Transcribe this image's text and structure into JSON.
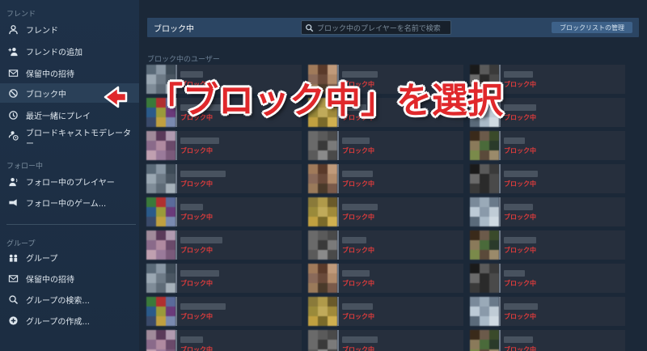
{
  "sidebar": {
    "friends_section": "フレンド",
    "friends_items": [
      {
        "label": "フレンド",
        "icon": "person-icon"
      },
      {
        "label": "フレンドの追加",
        "icon": "add-person-icon"
      },
      {
        "label": "保留中の招待",
        "icon": "envelope-icon"
      },
      {
        "label": "ブロック中",
        "icon": "block-icon"
      },
      {
        "label": "最近一緒にプレイ",
        "icon": "clock-icon"
      },
      {
        "label": "ブロードキャストモデレーター",
        "icon": "moderator-icon"
      }
    ],
    "follow_section": "フォロー中",
    "follow_items": [
      {
        "label": "フォロー中のプレイヤー",
        "icon": "follow-person-icon"
      },
      {
        "label": "フォロー中のゲーム...",
        "icon": "follow-game-icon"
      }
    ],
    "groups_section": "グループ",
    "groups_items": [
      {
        "label": "グループ",
        "icon": "group-icon"
      },
      {
        "label": "保留中の招待",
        "icon": "envelope-icon"
      },
      {
        "label": "グループの検索...",
        "icon": "search-icon"
      },
      {
        "label": "グループの作成...",
        "icon": "plus-circle-icon"
      }
    ]
  },
  "header": {
    "title": "ブロック中",
    "search_placeholder": "ブロック中のプレイヤーを名前で検索",
    "manage_button": "ブロックリストの管理"
  },
  "section_label": "ブロック中のユーザー",
  "blocked_status": "ブロック中",
  "annotation": {
    "text": "「ブロック中」を選択"
  },
  "colors": {
    "accent_red": "#e0282b",
    "status_red": "#e03c3c",
    "bg": "#1b2838",
    "card": "#262f3d"
  }
}
